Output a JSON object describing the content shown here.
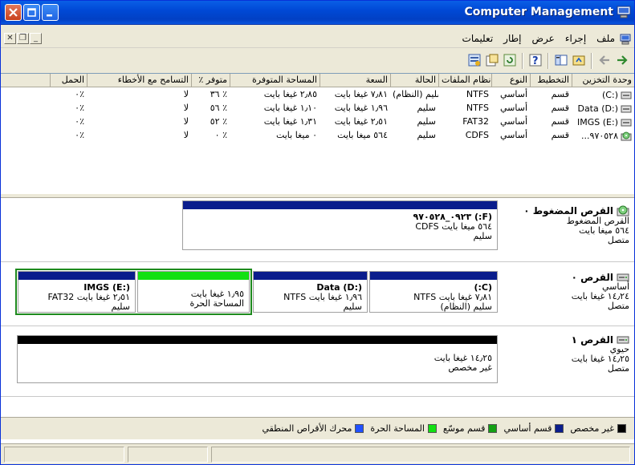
{
  "window": {
    "title": "Computer Management",
    "colors": {
      "titlebar": "#0054e3",
      "selection": "#1e8a1e"
    }
  },
  "menu": {
    "items": [
      "ملف",
      "إجراء",
      "عرض",
      "إطار",
      "تعليمات"
    ]
  },
  "toolbar": {
    "icons": [
      "back-icon",
      "forward-icon",
      "up-icon",
      "show-hide-tree-icon",
      "help-icon",
      "properties-icon",
      "refresh-icon",
      "export-icon",
      "view-icon"
    ]
  },
  "volumes": {
    "columns": [
      "وحدة التخزين",
      "التخطيط",
      "النوع",
      "نظام الملفات",
      "الحالة",
      "السعة",
      "المساحة المتوفرة",
      "٪ متوفر",
      "التسامح مع الأخطاء",
      "الحمل"
    ],
    "rows": [
      {
        "volume": "(C:)",
        "layout": "قسم",
        "type": "أساسي",
        "fs": "NTFS",
        "status": "سليم (النظام)",
        "capacity": "٧٫٨١ غيغا بايت",
        "free": "٢٫٨٥ غيغا بايت",
        "pct": "٣٦ ٪",
        "fault": "لا",
        "overhead": "٠٪",
        "icon": "volume-icon"
      },
      {
        "volume": "Data (D:)",
        "layout": "قسم",
        "type": "أساسي",
        "fs": "NTFS",
        "status": "سليم",
        "capacity": "١٫٩٦ غيغا بايت",
        "free": "١٫١٠ غيغا بايت",
        "pct": "٥٦ ٪",
        "fault": "لا",
        "overhead": "٠٪",
        "icon": "volume-icon"
      },
      {
        "volume": "IMGS (E:)",
        "layout": "قسم",
        "type": "أساسي",
        "fs": "FAT32",
        "status": "سليم",
        "capacity": "٢٫٥١ غيغا بايت",
        "free": "١٫٣١ غيغا بايت",
        "pct": "٥٢ ٪",
        "fault": "لا",
        "overhead": "٠٪",
        "icon": "volume-icon"
      },
      {
        "volume": "...٩٧٠٥٢٨",
        "layout": "قسم",
        "type": "أساسي",
        "fs": "CDFS",
        "status": "سليم",
        "capacity": "٥٦٤ ميغا بايت",
        "free": "٠ ميغا بايت",
        "pct": "٠ ٪",
        "fault": "لا",
        "overhead": "٠٪",
        "icon": "cdrom-icon"
      }
    ]
  },
  "disks": {
    "cdrom": {
      "name": "القرص المضغوط ٠",
      "type": "القرص المضغوط",
      "size": "٥٦٤ ميغا بايت",
      "state": "متصل",
      "partition": {
        "label": "(F:) ٠٩٢٣_٩٧٠٥٢٨",
        "size": "٥٦٤ ميغا بايت CDFS",
        "status": "سليم",
        "color": "#0a1d8c"
      }
    },
    "disk0": {
      "name": "القرص ٠",
      "type": "أساسي",
      "size": "١٤٫٢٤ غيغا بايت",
      "state": "متصل",
      "partitions": [
        {
          "label": "(C:)",
          "size": "٧٫٨١ غيغا بايت NTFS",
          "status": "سليم (النظام)",
          "color": "#0a1d8c"
        },
        {
          "label": "Data (D:)",
          "size": "١٫٩٦ غيغا بايت NTFS",
          "status": "سليم",
          "color": "#0a1d8c"
        },
        {
          "label": "",
          "size": "١٫٩٥ غيغا بايت",
          "status": "المساحة الحرة",
          "color": "#12e012"
        },
        {
          "label": "IMGS (E:)",
          "size": "٢٫٥١ غيغا بايت FAT32",
          "status": "سليم",
          "color": "#0a1d8c"
        }
      ]
    },
    "disk1": {
      "name": "القرص ١",
      "type": "حيوي",
      "size": "١٤٫٢٥ غيغا بايت",
      "state": "متصل",
      "partition": {
        "size": "١٤٫٢٥ غيغا بايت",
        "status": "غير مخصص",
        "color": "#000000"
      }
    }
  },
  "legend": [
    {
      "label": "غير مخصص",
      "color": "#000000"
    },
    {
      "label": "قسم أساسي",
      "color": "#0a1d8c"
    },
    {
      "label": "قسم موسّع",
      "color": "#14a014"
    },
    {
      "label": "المساحة الحرة",
      "color": "#12e012"
    },
    {
      "label": "محرك الأقراص المنطقي",
      "color": "#2050ff"
    }
  ]
}
